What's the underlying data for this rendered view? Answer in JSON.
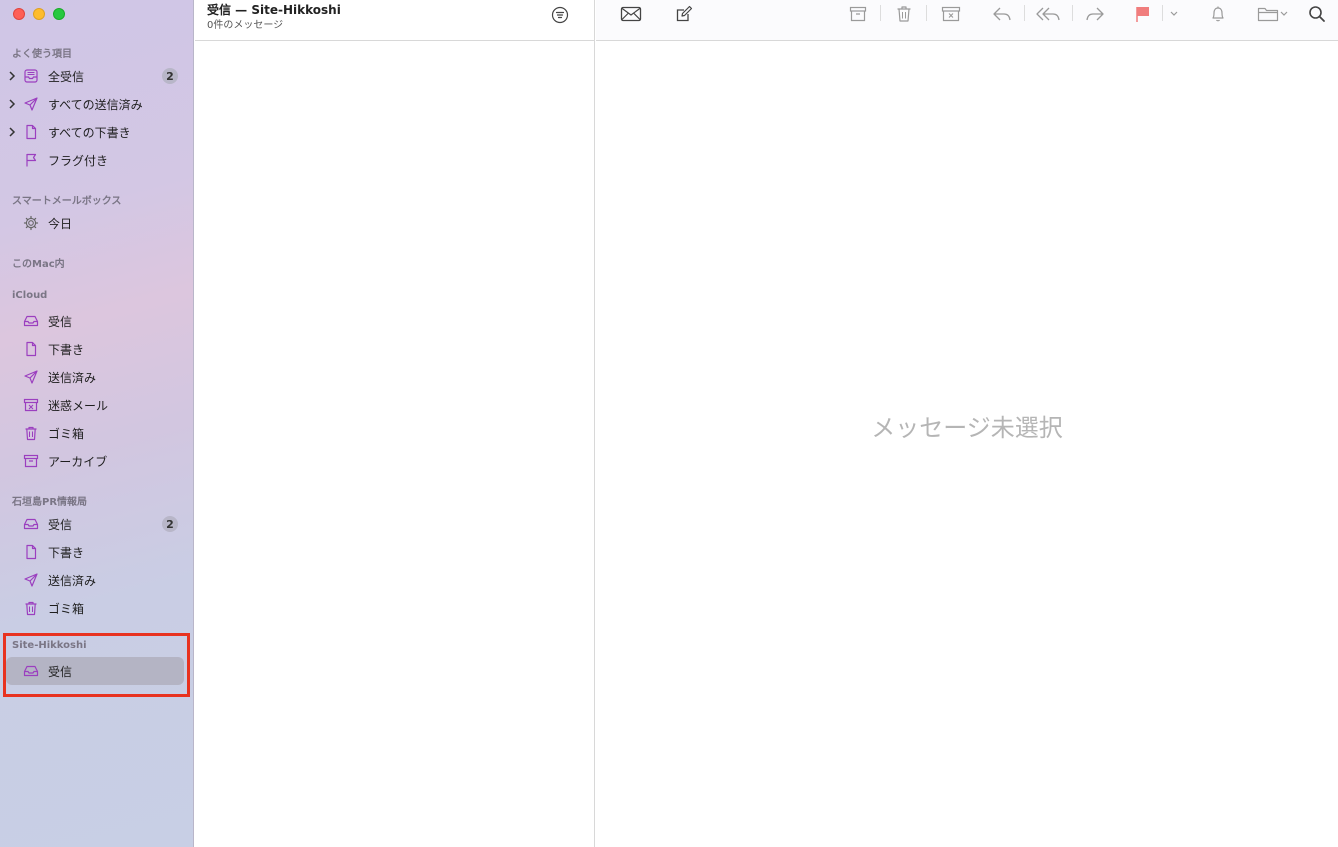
{
  "sidebar": {
    "favorites": {
      "title": "よく使う項目",
      "items": [
        {
          "label": "全受信",
          "badge": "2"
        },
        {
          "label": "すべての送信済み"
        },
        {
          "label": "すべての下書き"
        },
        {
          "label": "フラグ付き"
        }
      ]
    },
    "smart": {
      "title": "スマートメールボックス",
      "items": [
        {
          "label": "今日"
        }
      ]
    },
    "on_mac": {
      "title": "このMac内"
    },
    "icloud": {
      "title": "iCloud",
      "items": [
        {
          "label": "受信"
        },
        {
          "label": "下書き"
        },
        {
          "label": "送信済み"
        },
        {
          "label": "迷惑メール"
        },
        {
          "label": "ゴミ箱"
        },
        {
          "label": "アーカイブ"
        }
      ]
    },
    "ishigaki": {
      "title": "石垣島PR情報局",
      "items": [
        {
          "label": "受信",
          "badge": "2"
        },
        {
          "label": "下書き"
        },
        {
          "label": "送信済み"
        },
        {
          "label": "ゴミ箱"
        }
      ]
    },
    "site": {
      "title": "Site-Hikkoshi",
      "items": [
        {
          "label": "受信"
        }
      ]
    }
  },
  "list": {
    "title": "受信 — Site-Hikkoshi",
    "subtitle": "0件のメッセージ"
  },
  "reader": {
    "empty_text": "メッセージ未選択"
  },
  "colors": {
    "accent": "#9b3fbf",
    "flag": "#f07d7d",
    "highlight": "#e8321f"
  }
}
